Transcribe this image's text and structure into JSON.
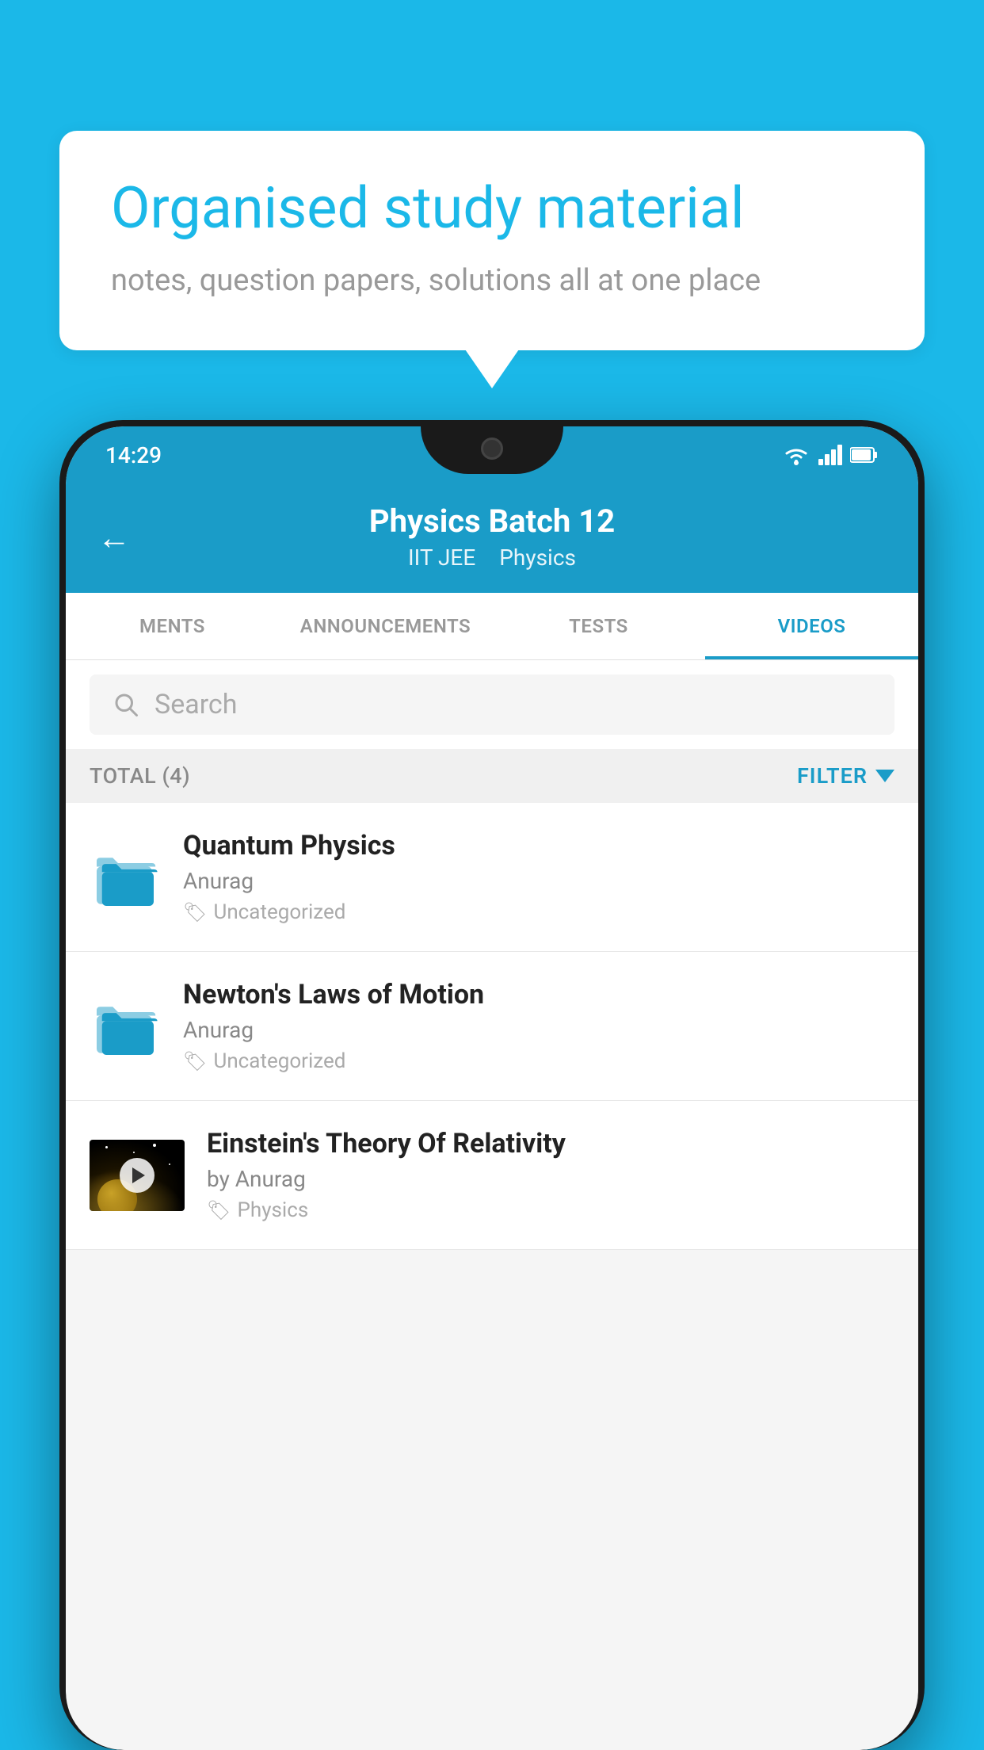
{
  "background_color": "#1BB8E8",
  "bubble": {
    "title": "Organised study material",
    "subtitle": "notes, question papers, solutions all at one place"
  },
  "status_bar": {
    "time": "14:29",
    "icons": [
      "wifi",
      "signal",
      "battery"
    ]
  },
  "app_header": {
    "back_label": "←",
    "title": "Physics Batch 12",
    "tag1": "IIT JEE",
    "tag2": "Physics"
  },
  "tabs": [
    {
      "label": "MENTS",
      "active": false
    },
    {
      "label": "ANNOUNCEMENTS",
      "active": false
    },
    {
      "label": "TESTS",
      "active": false
    },
    {
      "label": "VIDEOS",
      "active": true
    }
  ],
  "search": {
    "placeholder": "Search"
  },
  "filter_bar": {
    "total_label": "TOTAL (4)",
    "filter_label": "FILTER"
  },
  "videos": [
    {
      "type": "folder",
      "title": "Quantum Physics",
      "author": "Anurag",
      "tag": "Uncategorized"
    },
    {
      "type": "folder",
      "title": "Newton's Laws of Motion",
      "author": "Anurag",
      "tag": "Uncategorized"
    },
    {
      "type": "video",
      "title": "Einstein's Theory Of Relativity",
      "author": "by Anurag",
      "tag": "Physics"
    }
  ]
}
